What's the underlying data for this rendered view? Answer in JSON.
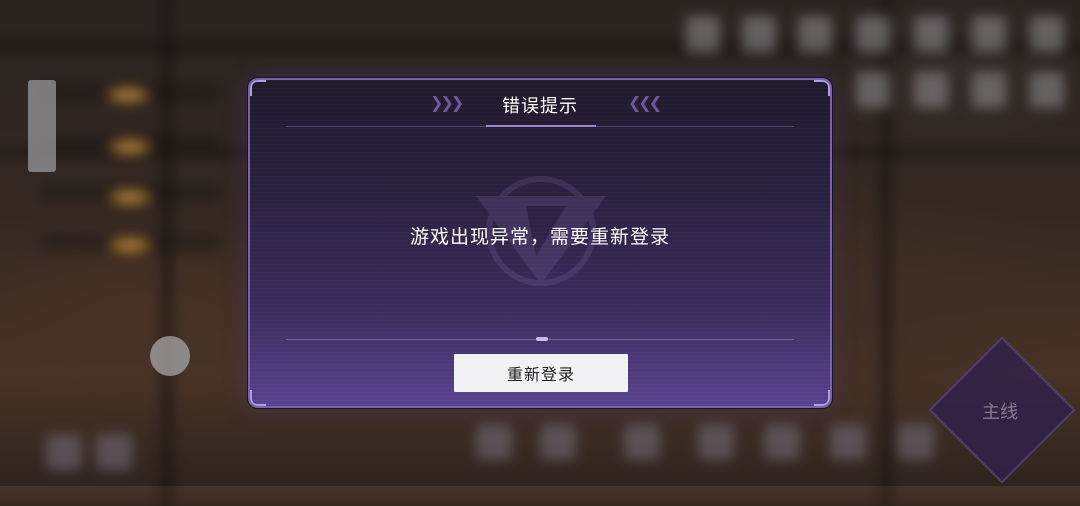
{
  "dialog": {
    "title": "错误提示",
    "message": "游戏出现异常，需要重新登录",
    "relogin_button": "重新登录"
  },
  "hud": {
    "main_button_label": "主线"
  },
  "colors": {
    "dialog_border": "#7a63a6",
    "dialog_bg_top": "#1f1a2c",
    "dialog_bg_bottom": "#5a4390",
    "button_bg": "#f2f2f4",
    "accent_purple": "#9d86cf"
  },
  "icons": [
    "chevron-right-icon",
    "chevron-left-icon",
    "game-logo-icon"
  ]
}
